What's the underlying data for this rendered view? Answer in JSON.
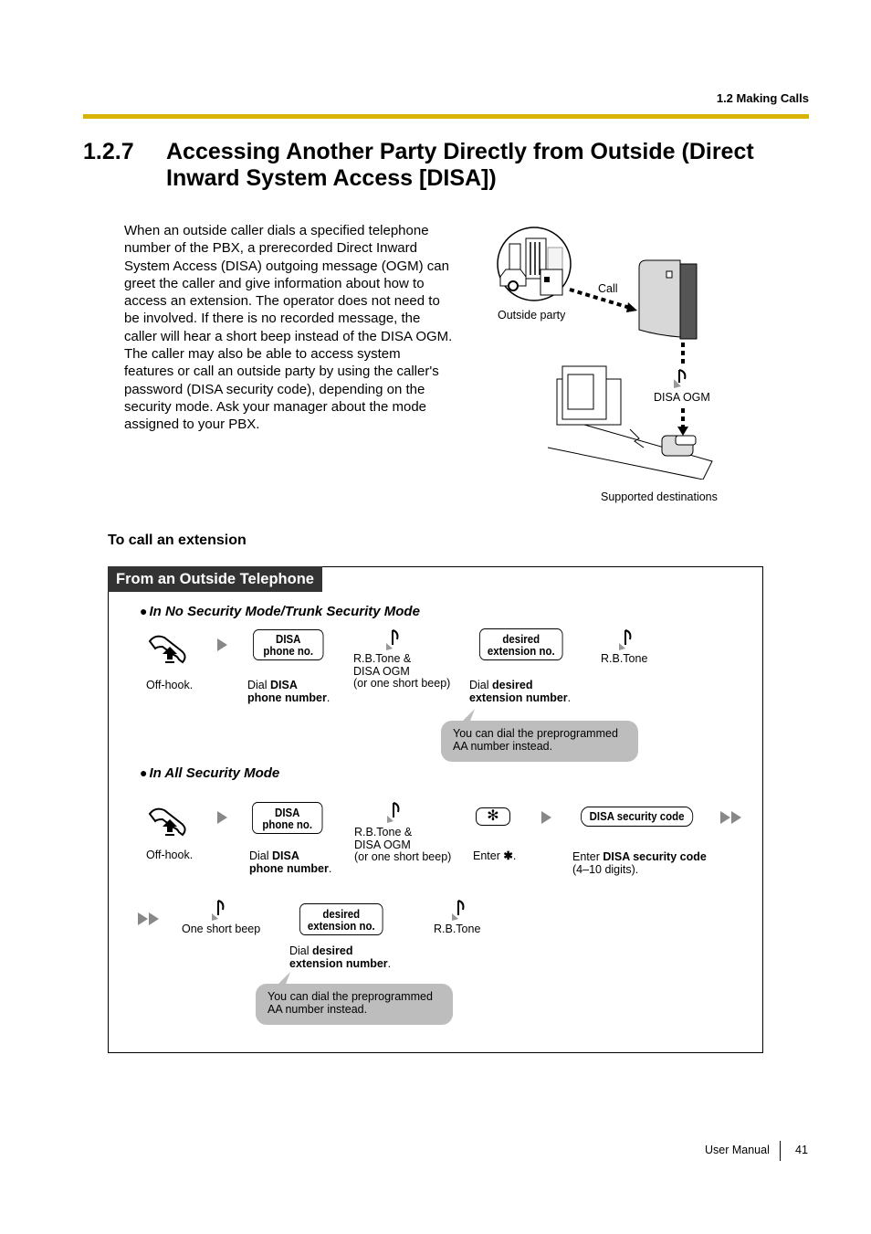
{
  "header": {
    "section_ref": "1.2 Making Calls",
    "rule_color": "#d8b400"
  },
  "section": {
    "number": "1.2.7",
    "title": "Accessing Another Party Directly from Outside (Direct Inward System Access [DISA])"
  },
  "intro": {
    "paragraph1": "When an outside caller dials a specified telephone number of the PBX, a prerecorded Direct Inward System Access (DISA) outgoing message (OGM) can greet the caller and give information about how to access an extension. The operator does not need to be involved. If there is no recorded message, the caller will hear a short beep instead of the DISA OGM.",
    "paragraph2": "The caller may also be able to access system features or call an outside party by using the caller's password (DISA security code), depending on the security mode. Ask your manager about the mode assigned to your PBX."
  },
  "illustration": {
    "outside_party": "Outside party",
    "call": "Call",
    "disa_ogm": "DISA OGM",
    "supported_destinations": "Supported destinations"
  },
  "subheading": "To call an extension",
  "procedure": {
    "tab_label": "From an Outside Telephone",
    "mode1": {
      "heading": "In No Security Mode/Trunk Security Mode",
      "steps": {
        "offhook": "Off-hook.",
        "key_disa_line1": "DISA",
        "key_disa_line2": "phone no.",
        "dial_disa_pre": "Dial ",
        "dial_disa_bold1": "DISA",
        "dial_disa_bold2": "phone number",
        "dial_disa_post": ".",
        "tone1_line1": "R.B.Tone &",
        "tone1_line2": "DISA OGM",
        "tone1_line3": "(or one short beep)",
        "key_ext_line1": "desired",
        "key_ext_line2": "extension no.",
        "dial_ext_pre": "Dial ",
        "dial_ext_bold1": "desired",
        "dial_ext_bold2": "extension number",
        "dial_ext_post": ".",
        "tone2": "R.B.Tone",
        "note": "You can dial the preprogrammed AA number instead."
      }
    },
    "mode2": {
      "heading": "In All Security Mode",
      "steps": {
        "offhook": "Off-hook.",
        "key_disa_line1": "DISA",
        "key_disa_line2": "phone no.",
        "dial_disa_pre": "Dial ",
        "dial_disa_bold1": "DISA",
        "dial_disa_bold2": "phone number",
        "dial_disa_post": ".",
        "tone1_line1": "R.B.Tone &",
        "tone1_line2": "DISA OGM",
        "tone1_line3": "(or one short beep)",
        "key_star": "✻",
        "enter_star_pre": "Enter ",
        "enter_star_sym": "✱",
        "enter_star_post": ".",
        "key_security": "DISA security code",
        "enter_code_pre": "Enter ",
        "enter_code_bold": "DISA security code",
        "enter_code_line2": "(4–10 digits).",
        "short_beep": "One short beep",
        "key_ext_line1": "desired",
        "key_ext_line2": "extension no.",
        "dial_ext_pre": "Dial ",
        "dial_ext_bold1": "desired",
        "dial_ext_bold2": "extension number",
        "dial_ext_post": ".",
        "tone2": "R.B.Tone",
        "note": "You can dial the preprogrammed AA number instead."
      }
    }
  },
  "footer": {
    "label": "User Manual",
    "page": "41"
  }
}
